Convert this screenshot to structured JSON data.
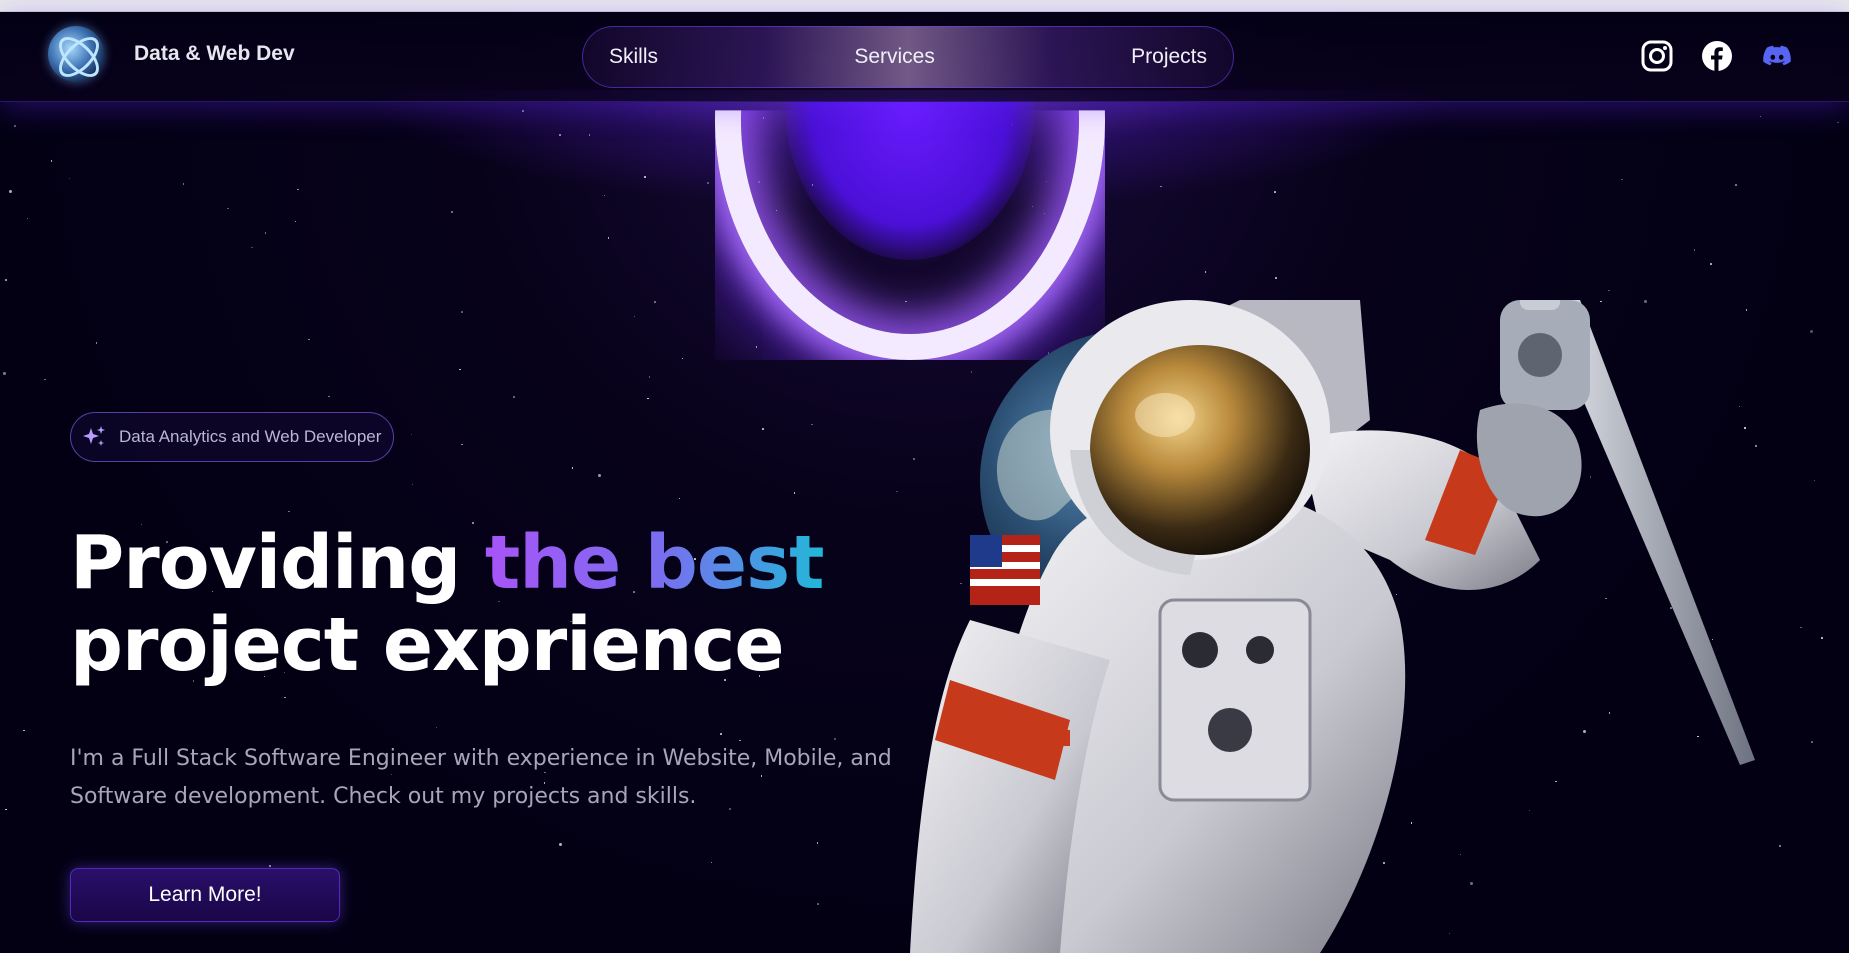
{
  "header": {
    "brand_name": "Data & Web Dev",
    "nav": [
      "Skills",
      "Services",
      "Projects"
    ],
    "socials": [
      "instagram-icon",
      "facebook-icon",
      "discord-icon"
    ]
  },
  "hero": {
    "badge_text": "Data Analytics and Web Developer",
    "headline_line1_start": "Providing ",
    "headline_line1_highlight": "the best",
    "headline_line2": "project exprience",
    "intro": "I'm a Full Stack Software Engineer with experience in Website, Mobile, and Software development. Check out my projects and skills.",
    "cta_label": "Learn More!"
  },
  "colors": {
    "background": "#030014",
    "accent": "#7042f8",
    "gradient_start": "#a855f7",
    "gradient_end": "#22b8d8",
    "discord": "#5865f2"
  }
}
